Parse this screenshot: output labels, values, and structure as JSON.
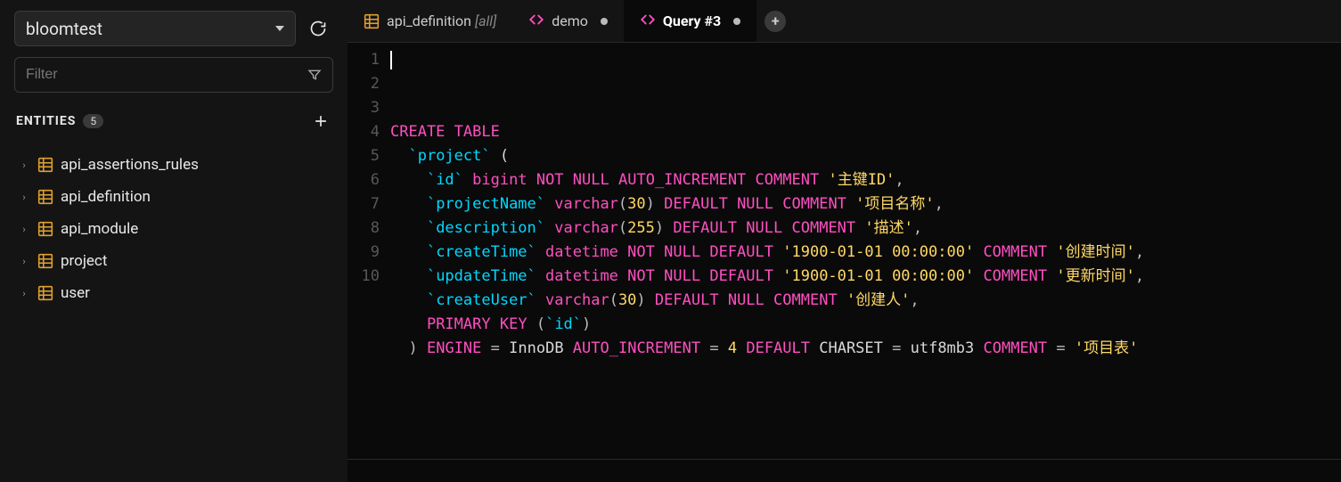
{
  "sidebar": {
    "database": "bloomtest",
    "filterPlaceholder": "Filter",
    "entitiesLabel": "ENTITIES",
    "entityCount": "5",
    "items": [
      {
        "label": "api_assertions_rules"
      },
      {
        "label": "api_definition"
      },
      {
        "label": "api_module"
      },
      {
        "label": "project"
      },
      {
        "label": "user"
      }
    ]
  },
  "tabs": [
    {
      "kind": "table",
      "label": "api_definition",
      "suffix": "[all]",
      "dirty": false,
      "active": false
    },
    {
      "kind": "code",
      "label": "demo",
      "dirty": true,
      "active": false
    },
    {
      "kind": "code",
      "label": "Query #3",
      "dirty": true,
      "active": true
    }
  ],
  "editor": {
    "lines": [
      [
        {
          "c": "kw",
          "t": "CREATE"
        },
        {
          "c": "plain",
          "t": " "
        },
        {
          "c": "kw",
          "t": "TABLE"
        }
      ],
      [
        {
          "c": "plain",
          "t": "  "
        },
        {
          "c": "ident",
          "t": "`project`"
        },
        {
          "c": "plain",
          "t": " ("
        }
      ],
      [
        {
          "c": "plain",
          "t": "    "
        },
        {
          "c": "ident",
          "t": "`id`"
        },
        {
          "c": "plain",
          "t": " "
        },
        {
          "c": "type",
          "t": "bigint"
        },
        {
          "c": "plain",
          "t": " "
        },
        {
          "c": "kw",
          "t": "NOT"
        },
        {
          "c": "plain",
          "t": " "
        },
        {
          "c": "kw",
          "t": "NULL"
        },
        {
          "c": "plain",
          "t": " "
        },
        {
          "c": "attr",
          "t": "AUTO_INCREMENT"
        },
        {
          "c": "plain",
          "t": " "
        },
        {
          "c": "kw",
          "t": "COMMENT"
        },
        {
          "c": "plain",
          "t": " "
        },
        {
          "c": "str",
          "t": "'主键ID'"
        },
        {
          "c": "punc",
          "t": ","
        }
      ],
      [
        {
          "c": "plain",
          "t": "    "
        },
        {
          "c": "ident",
          "t": "`projectName`"
        },
        {
          "c": "plain",
          "t": " "
        },
        {
          "c": "type",
          "t": "varchar"
        },
        {
          "c": "punc",
          "t": "("
        },
        {
          "c": "num",
          "t": "30"
        },
        {
          "c": "punc",
          "t": ")"
        },
        {
          "c": "plain",
          "t": " "
        },
        {
          "c": "kw",
          "t": "DEFAULT"
        },
        {
          "c": "plain",
          "t": " "
        },
        {
          "c": "kw",
          "t": "NULL"
        },
        {
          "c": "plain",
          "t": " "
        },
        {
          "c": "kw",
          "t": "COMMENT"
        },
        {
          "c": "plain",
          "t": " "
        },
        {
          "c": "str",
          "t": "'项目名称'"
        },
        {
          "c": "punc",
          "t": ","
        }
      ],
      [
        {
          "c": "plain",
          "t": "    "
        },
        {
          "c": "ident",
          "t": "`description`"
        },
        {
          "c": "plain",
          "t": " "
        },
        {
          "c": "type",
          "t": "varchar"
        },
        {
          "c": "punc",
          "t": "("
        },
        {
          "c": "num",
          "t": "255"
        },
        {
          "c": "punc",
          "t": ")"
        },
        {
          "c": "plain",
          "t": " "
        },
        {
          "c": "kw",
          "t": "DEFAULT"
        },
        {
          "c": "plain",
          "t": " "
        },
        {
          "c": "kw",
          "t": "NULL"
        },
        {
          "c": "plain",
          "t": " "
        },
        {
          "c": "kw",
          "t": "COMMENT"
        },
        {
          "c": "plain",
          "t": " "
        },
        {
          "c": "str",
          "t": "'描述'"
        },
        {
          "c": "punc",
          "t": ","
        }
      ],
      [
        {
          "c": "plain",
          "t": "    "
        },
        {
          "c": "ident",
          "t": "`createTime`"
        },
        {
          "c": "plain",
          "t": " "
        },
        {
          "c": "type",
          "t": "datetime"
        },
        {
          "c": "plain",
          "t": " "
        },
        {
          "c": "kw",
          "t": "NOT"
        },
        {
          "c": "plain",
          "t": " "
        },
        {
          "c": "kw",
          "t": "NULL"
        },
        {
          "c": "plain",
          "t": " "
        },
        {
          "c": "kw",
          "t": "DEFAULT"
        },
        {
          "c": "plain",
          "t": " "
        },
        {
          "c": "str",
          "t": "'1900-01-01 00:00:00'"
        },
        {
          "c": "plain",
          "t": " "
        },
        {
          "c": "kw",
          "t": "COMMENT"
        },
        {
          "c": "plain",
          "t": " "
        },
        {
          "c": "str",
          "t": "'创建时间'"
        },
        {
          "c": "punc",
          "t": ","
        }
      ],
      [
        {
          "c": "plain",
          "t": "    "
        },
        {
          "c": "ident",
          "t": "`updateTime`"
        },
        {
          "c": "plain",
          "t": " "
        },
        {
          "c": "type",
          "t": "datetime"
        },
        {
          "c": "plain",
          "t": " "
        },
        {
          "c": "kw",
          "t": "NOT"
        },
        {
          "c": "plain",
          "t": " "
        },
        {
          "c": "kw",
          "t": "NULL"
        },
        {
          "c": "plain",
          "t": " "
        },
        {
          "c": "kw",
          "t": "DEFAULT"
        },
        {
          "c": "plain",
          "t": " "
        },
        {
          "c": "str",
          "t": "'1900-01-01 00:00:00'"
        },
        {
          "c": "plain",
          "t": " "
        },
        {
          "c": "kw",
          "t": "COMMENT"
        },
        {
          "c": "plain",
          "t": " "
        },
        {
          "c": "str",
          "t": "'更新时间'"
        },
        {
          "c": "punc",
          "t": ","
        }
      ],
      [
        {
          "c": "plain",
          "t": "    "
        },
        {
          "c": "ident",
          "t": "`createUser`"
        },
        {
          "c": "plain",
          "t": " "
        },
        {
          "c": "type",
          "t": "varchar"
        },
        {
          "c": "punc",
          "t": "("
        },
        {
          "c": "num",
          "t": "30"
        },
        {
          "c": "punc",
          "t": ")"
        },
        {
          "c": "plain",
          "t": " "
        },
        {
          "c": "kw",
          "t": "DEFAULT"
        },
        {
          "c": "plain",
          "t": " "
        },
        {
          "c": "kw",
          "t": "NULL"
        },
        {
          "c": "plain",
          "t": " "
        },
        {
          "c": "kw",
          "t": "COMMENT"
        },
        {
          "c": "plain",
          "t": " "
        },
        {
          "c": "str",
          "t": "'创建人'"
        },
        {
          "c": "punc",
          "t": ","
        }
      ],
      [
        {
          "c": "plain",
          "t": "    "
        },
        {
          "c": "kw",
          "t": "PRIMARY"
        },
        {
          "c": "plain",
          "t": " "
        },
        {
          "c": "kw",
          "t": "KEY"
        },
        {
          "c": "plain",
          "t": " "
        },
        {
          "c": "punc",
          "t": "("
        },
        {
          "c": "ident",
          "t": "`id`"
        },
        {
          "c": "punc",
          "t": ")"
        }
      ],
      [
        {
          "c": "plain",
          "t": "  "
        },
        {
          "c": "punc",
          "t": ")"
        },
        {
          "c": "plain",
          "t": " "
        },
        {
          "c": "kw",
          "t": "ENGINE"
        },
        {
          "c": "plain",
          "t": " "
        },
        {
          "c": "punc",
          "t": "="
        },
        {
          "c": "plain",
          "t": " InnoDB "
        },
        {
          "c": "attr",
          "t": "AUTO_INCREMENT"
        },
        {
          "c": "plain",
          "t": " "
        },
        {
          "c": "punc",
          "t": "="
        },
        {
          "c": "plain",
          "t": " "
        },
        {
          "c": "num",
          "t": "4"
        },
        {
          "c": "plain",
          "t": " "
        },
        {
          "c": "kw",
          "t": "DEFAULT"
        },
        {
          "c": "plain",
          "t": " CHARSET "
        },
        {
          "c": "punc",
          "t": "="
        },
        {
          "c": "plain",
          "t": " utf8mb3 "
        },
        {
          "c": "kw",
          "t": "COMMENT"
        },
        {
          "c": "plain",
          "t": " "
        },
        {
          "c": "punc",
          "t": "="
        },
        {
          "c": "plain",
          "t": " "
        },
        {
          "c": "str",
          "t": "'项目表'"
        }
      ]
    ]
  }
}
